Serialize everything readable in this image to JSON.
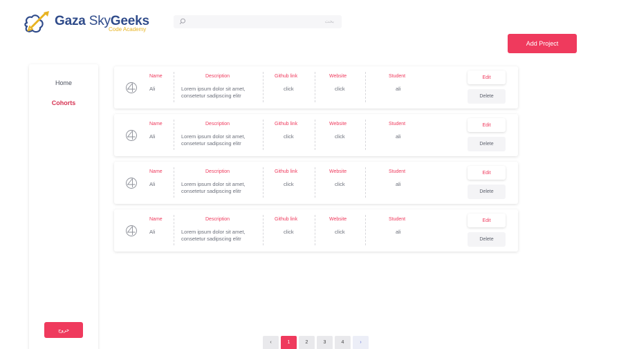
{
  "logo": {
    "word_gaza": "Gaza",
    "word_sky": "Sky",
    "word_geeks": "Geeks",
    "subtitle": "Code Academy"
  },
  "search": {
    "placeholder": "بحث"
  },
  "header": {
    "add_project_label": "Add Project"
  },
  "sidebar": {
    "items": [
      {
        "label": "Home"
      },
      {
        "label": "Cohorts"
      }
    ],
    "logout_label": "خروج"
  },
  "columns": {
    "name": "Name",
    "description": "Description",
    "github": "Github link",
    "website": "Website",
    "student": "Student"
  },
  "projects": [
    {
      "name": "Ali",
      "description_line1": "Lorem ipsum dolor sit amet,",
      "description_line2": "consetetur sadipscing elitr",
      "github": "click",
      "website": "click",
      "student": "ali"
    },
    {
      "name": "Ali",
      "description_line1": "Lorem ipsum dolor sit amet,",
      "description_line2": "consetetur sadipscing elitr",
      "github": "click",
      "website": "click",
      "student": "ali"
    },
    {
      "name": "Ali",
      "description_line1": "Lorem ipsum dolor sit amet,",
      "description_line2": "consetetur sadipscing elitr",
      "github": "click",
      "website": "click",
      "student": "ali"
    },
    {
      "name": "Ali",
      "description_line1": "Lorem ipsum dolor sit amet,",
      "description_line2": "consetetur sadipscing elitr",
      "github": "click",
      "website": "click",
      "student": "ali"
    }
  ],
  "actions": {
    "edit_label": "Edit",
    "delete_label": "Delete"
  },
  "pagination": {
    "prev": "‹",
    "pages": [
      "1",
      "2",
      "3",
      "4"
    ],
    "current": "1",
    "next": "›"
  },
  "colors": {
    "accent": "#ef3a5d",
    "brand_blue": "#2f4b8a",
    "brand_yellow": "#e8b321"
  }
}
